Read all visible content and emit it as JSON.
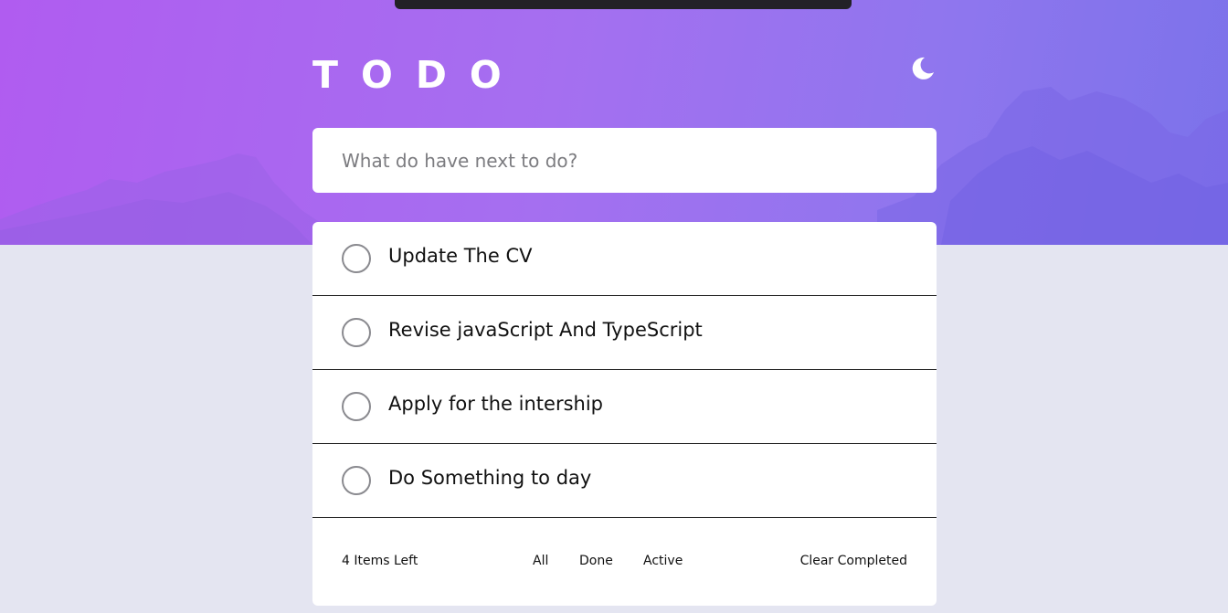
{
  "header": {
    "title": "TODO"
  },
  "theme_toggle": {
    "icon": "moon-icon"
  },
  "new_todo": {
    "placeholder": "What do have next to do?",
    "value": ""
  },
  "todos": [
    {
      "text": "Update The CV",
      "done": false
    },
    {
      "text": "Revise javaScript And TypeScript",
      "done": false
    },
    {
      "text": "Apply for the intership",
      "done": false
    },
    {
      "text": "Do Something to day",
      "done": false
    }
  ],
  "footer": {
    "items_left": "4 Items Left",
    "filters": [
      "All",
      "Done",
      "Active"
    ],
    "clear_label": "Clear Completed"
  },
  "colors": {
    "gradient_start": "#b05cf0",
    "gradient_end": "#7b72ea",
    "page_background": "#e4e5f1",
    "card": "#ffffff"
  }
}
